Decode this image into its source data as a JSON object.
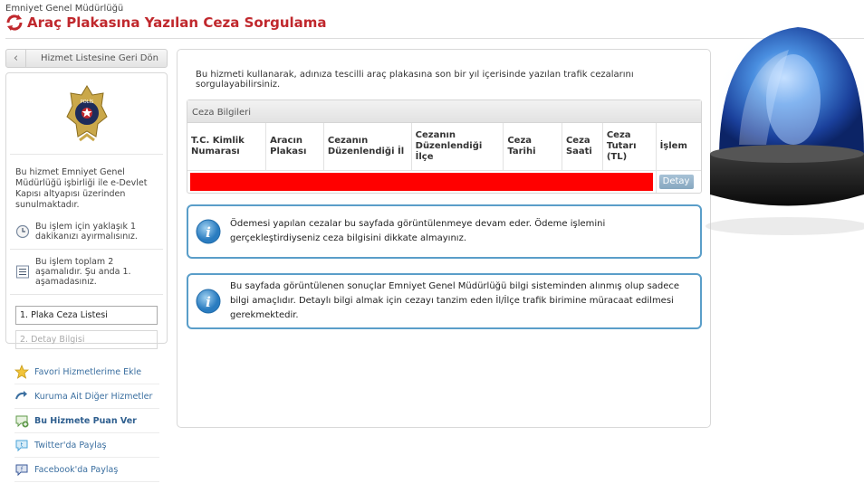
{
  "header": {
    "org": "Emniyet Genel Müdürlüğü",
    "title": "Araç Plakasına Yazılan Ceza Sorgulama"
  },
  "sidebar": {
    "back_label": "Hizmet Listesine Geri Dön",
    "badge_text": "POLİS",
    "description": "Bu hizmet Emniyet Genel Müdürlüğü işbirliği ile e-Devlet Kapısı altyapısı üzerinden sunulmaktadır.",
    "time_info": "Bu işlem için yaklaşık 1 dakikanızı ayırmalısınız.",
    "steps_info": "Bu işlem toplam 2 aşamalıdır. Şu anda 1. aşamadasınız.",
    "steps": [
      {
        "label": "1. Plaka Ceza Listesi"
      },
      {
        "label": "2. Detay Bilgisi"
      }
    ]
  },
  "links": [
    {
      "label": "Favori Hizmetlerime Ekle",
      "icon": "star-icon"
    },
    {
      "label": "Kuruma Ait Diğer Hizmetler",
      "icon": "arrow-icon"
    },
    {
      "label": "Bu Hizmete Puan Ver",
      "icon": "rating-bubble-icon"
    },
    {
      "label": "Twitter'da Paylaş",
      "icon": "twitter-icon"
    },
    {
      "label": "Facebook'da Paylaş",
      "icon": "facebook-icon"
    }
  ],
  "main": {
    "intro": "Bu hizmeti kullanarak, adınıza tescilli araç plakasına son bir yıl içerisinde yazılan trafik cezalarını sorgulayabilirsiniz.",
    "panel_title": "Ceza Bilgileri",
    "columns": [
      "T.C. Kimlik Numarası",
      "Aracın Plakası",
      "Cezanın Düzenlendiği İl",
      "Cezanın Düzenlendiği İlçe",
      "Ceza Tarihi",
      "Ceza Saati",
      "Ceza Tutarı (TL)",
      "İşlem"
    ],
    "row_action": "Detay",
    "notice1": "Ödemesi yapılan cezalar bu sayfada görüntülenmeye devam eder. Ödeme işlemini gerçekleştirdiyseniz ceza bilgisini dikkate almayınız.",
    "notice2": "Bu sayfada görüntülenen sonuçlar Emniyet Genel Müdürlüğü bilgi sisteminden alınmış olup sadece bilgi amaçlıdır. Detaylı bilgi almak için cezayı tanzim eden İl/İlçe trafik birimine müracaat edilmesi gerekmektedir."
  },
  "colors": {
    "title_red": "#c0282d",
    "notice_border": "#5a9ec9",
    "redaction": "#ff0000",
    "link_blue": "#3b6fa0"
  }
}
